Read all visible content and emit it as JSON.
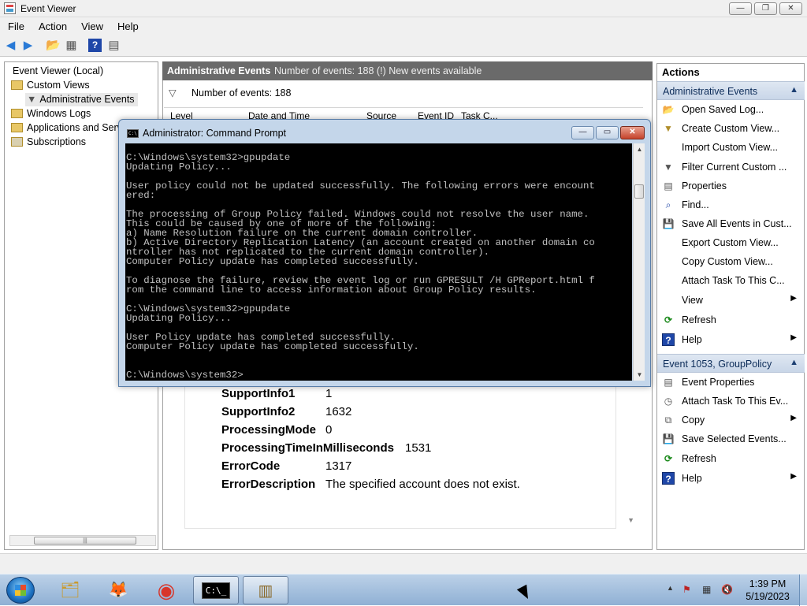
{
  "window": {
    "title": "Event Viewer",
    "min": "—",
    "max": "❐",
    "close": "✕"
  },
  "menu": [
    "File",
    "Action",
    "View",
    "Help"
  ],
  "toolbar": {
    "back": "◀",
    "forward": "▶",
    "folder": "📂",
    "view": "▦",
    "help": "?",
    "panel": "▤"
  },
  "tree": {
    "root": "Event Viewer (Local)",
    "custom_views": "Custom Views",
    "admin_events": "Administrative Events",
    "windows_logs": "Windows Logs",
    "app_services": "Applications and Serv",
    "subscriptions": "Subscriptions",
    "scroll_grip": "|||"
  },
  "center": {
    "header_title": "Administrative Events",
    "header_info": "Number of events: 188 (!) New events available",
    "filter_text": "Number of events: 188",
    "columns": [
      "Level",
      "Date and Time",
      "Source",
      "Event ID",
      "Task C..."
    ]
  },
  "details": [
    {
      "key": "SupportInfo1",
      "value": "1"
    },
    {
      "key": "SupportInfo2",
      "value": "1632"
    },
    {
      "key": "ProcessingMode",
      "value": "0"
    },
    {
      "key": "ProcessingTimeInMilliseconds",
      "value": "1531"
    },
    {
      "key": "ErrorCode",
      "value": "1317"
    },
    {
      "key": "ErrorDescription",
      "value": "The specified account does not exist."
    }
  ],
  "actions": {
    "title": "Actions",
    "section1": "Administrative Events",
    "items1": [
      {
        "label": "Open Saved Log...",
        "icon": "📂"
      },
      {
        "label": "Create Custom View...",
        "icon": "▼"
      },
      {
        "label": "Import Custom View...",
        "icon": ""
      },
      {
        "label": "Filter Current Custom ...",
        "icon": "▼"
      },
      {
        "label": "Properties",
        "icon": "▤"
      },
      {
        "label": "Find...",
        "icon": "⌕"
      },
      {
        "label": "Save All Events in Cust...",
        "icon": "💾"
      },
      {
        "label": "Export Custom View...",
        "icon": ""
      },
      {
        "label": "Copy Custom View...",
        "icon": ""
      },
      {
        "label": "Attach Task To This C...",
        "icon": ""
      },
      {
        "label": "View",
        "icon": "",
        "submenu": "▶"
      },
      {
        "label": "Refresh",
        "icon": "⟳"
      },
      {
        "label": "Help",
        "icon": "?",
        "submenu": "▶"
      }
    ],
    "section2": "Event 1053, GroupPolicy",
    "items2": [
      {
        "label": "Event Properties",
        "icon": "▤"
      },
      {
        "label": "Attach Task To This Ev...",
        "icon": "◷"
      },
      {
        "label": "Copy",
        "icon": "⧉",
        "submenu": "▶"
      },
      {
        "label": "Save Selected Events...",
        "icon": "💾"
      },
      {
        "label": "Refresh",
        "icon": "⟳"
      },
      {
        "label": "Help",
        "icon": "?",
        "submenu": "▶"
      }
    ],
    "collapse": "▲"
  },
  "cmd": {
    "title": "Administrator: Command Prompt",
    "icon_text": "C:\\",
    "min": "—",
    "max": "▭",
    "close": "✕",
    "output": "C:\\Windows\\system32>gpupdate\nUpdating Policy...\n\nUser policy could not be updated successfully. The following errors were encount\nered:\n\nThe processing of Group Policy failed. Windows could not resolve the user name.\nThis could be caused by one of more of the following:\na) Name Resolution failure on the current domain controller.\nb) Active Directory Replication Latency (an account created on another domain co\nntroller has not replicated to the current domain controller).\nComputer Policy update has completed successfully.\n\nTo diagnose the failure, review the event log or run GPRESULT /H GPReport.html f\nrom the command line to access information about Group Policy results.\n\nC:\\Windows\\system32>gpupdate\nUpdating Policy...\n\nUser Policy update has completed successfully.\nComputer Policy update has completed successfully.\n\n\nC:\\Windows\\system32>",
    "scroll_up": "▲",
    "scroll_down": "▼"
  },
  "taskbar": {
    "apps": [
      {
        "name": "file-explorer",
        "icon": "🗂"
      },
      {
        "name": "firefox",
        "icon": "🦊"
      },
      {
        "name": "chrome",
        "icon": "◉"
      },
      {
        "name": "command-prompt",
        "icon": "C:\\_"
      },
      {
        "name": "event-viewer",
        "icon": "▥"
      }
    ],
    "tray_arrow": "▲",
    "time": "1:39 PM",
    "date": "5/19/2023"
  }
}
